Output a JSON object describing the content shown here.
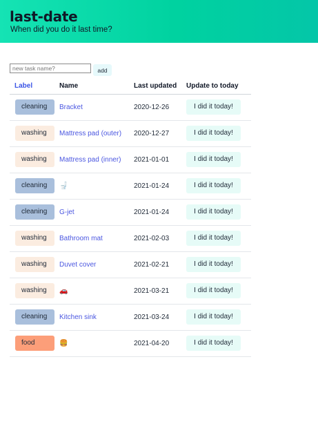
{
  "app": {
    "title": "last-date",
    "subtitle": "When did you do it last time?"
  },
  "form": {
    "placeholder": "new task name?",
    "value": "",
    "add_label": "add"
  },
  "colors": {
    "header_start": "#15e3b4",
    "cleaning": "#a9bfdc",
    "washing": "#fbece0",
    "food": "#fc9e79",
    "link": "#4a56e0",
    "did_button": "#e6fbf7"
  },
  "table": {
    "headers": {
      "label": "Label",
      "name": "Name",
      "last_updated": "Last updated",
      "update": "Update to today"
    },
    "rows": [
      {
        "label": "cleaning",
        "name": "Bracket",
        "date": "2020-12-26",
        "action": "I did it today!"
      },
      {
        "label": "washing",
        "name": "Mattress pad (outer)",
        "date": "2020-12-27",
        "action": "I did it today!"
      },
      {
        "label": "washing",
        "name": "Mattress pad (inner)",
        "date": "2021-01-01",
        "action": "I did it today!"
      },
      {
        "label": "cleaning",
        "name": "🚽",
        "date": "2021-01-24",
        "action": "I did it today!"
      },
      {
        "label": "cleaning",
        "name": "G-jet",
        "date": "2021-01-24",
        "action": "I did it today!"
      },
      {
        "label": "washing",
        "name": "Bathroom mat",
        "date": "2021-02-03",
        "action": "I did it today!"
      },
      {
        "label": "washing",
        "name": "Duvet cover",
        "date": "2021-02-21",
        "action": "I did it today!"
      },
      {
        "label": "washing",
        "name": "🚗",
        "date": "2021-03-21",
        "action": "I did it today!"
      },
      {
        "label": "cleaning",
        "name": "Kitchen sink",
        "date": "2021-03-24",
        "action": "I did it today!"
      },
      {
        "label": "food",
        "name": "🍔",
        "date": "2021-04-20",
        "action": "I did it today!"
      }
    ]
  }
}
